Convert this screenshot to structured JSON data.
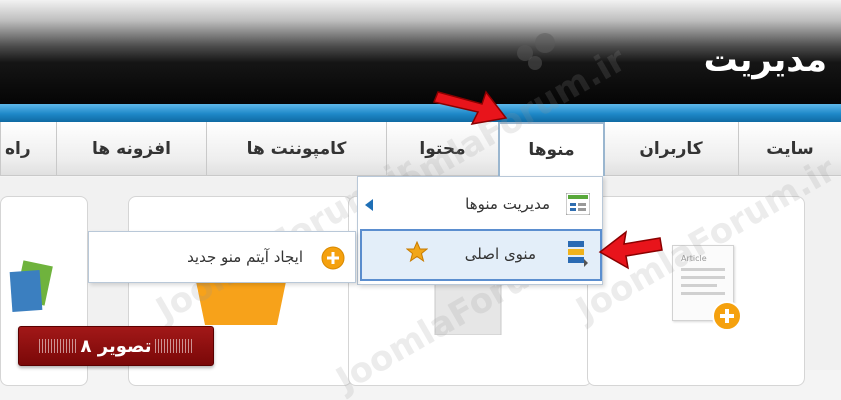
{
  "header": {
    "title": "مدیریت"
  },
  "nav": {
    "items": [
      {
        "label": "سایت"
      },
      {
        "label": "کاربران"
      },
      {
        "label": "منوها"
      },
      {
        "label": "محتوا"
      },
      {
        "label": "کامپوننت ها"
      },
      {
        "label": "افزونه ها"
      },
      {
        "label": "راه"
      }
    ]
  },
  "dropdown": {
    "manage_menus": "مدیریت منوها",
    "main_menu": "منوی اصلی"
  },
  "submenu": {
    "new_item": "ایجاد آیتم منو جدید"
  },
  "watermark": {
    "text": "JoomlaForum.ir"
  },
  "badge": {
    "label": "تصویر ۸"
  },
  "thumb": {
    "article_label": "Article"
  },
  "colors": {
    "arrow_red": "#e8141b",
    "accent_blue": "#1e88c8",
    "badge_red": "#8e1010",
    "add_orange": "#f5a10e"
  }
}
